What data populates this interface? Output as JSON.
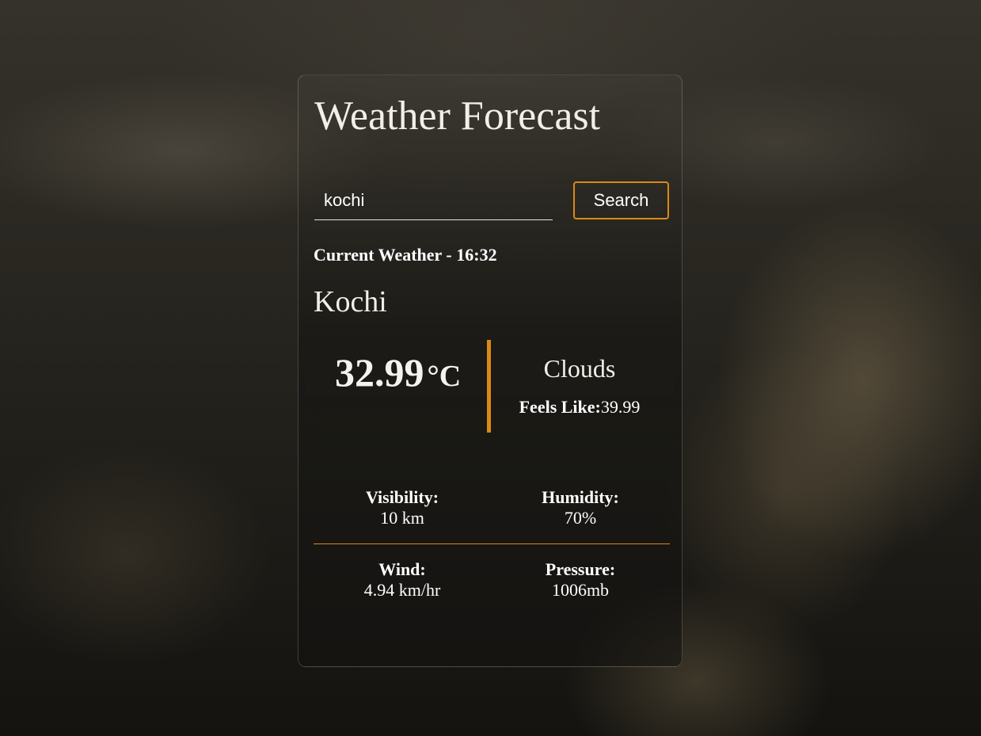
{
  "app": {
    "title": "Weather Forecast"
  },
  "search": {
    "value": "kochi",
    "button_label": "Search"
  },
  "current": {
    "heading": "Current Weather - 16:32",
    "city": "Kochi",
    "temperature": "32.99",
    "unit": "°C",
    "condition": "Clouds",
    "feels_like_label": "Feels Like:",
    "feels_like_value": "39.99"
  },
  "stats": {
    "visibility": {
      "label": "Visibility:",
      "value": "10 km"
    },
    "humidity": {
      "label": "Humidity:",
      "value": "70%"
    },
    "wind": {
      "label": "Wind:",
      "value": "4.94 km/hr"
    },
    "pressure": {
      "label": "Pressure:",
      "value": "1006mb"
    }
  },
  "colors": {
    "accent": "#d98a14",
    "text": "#ffffff"
  }
}
